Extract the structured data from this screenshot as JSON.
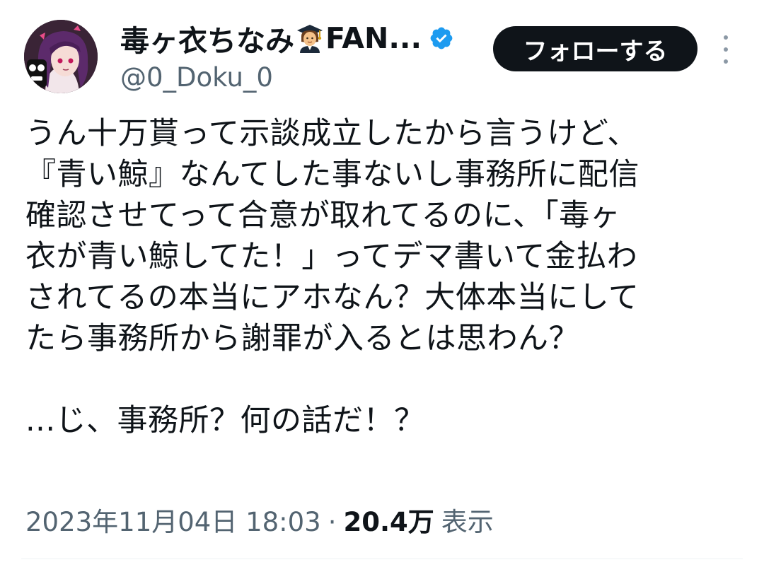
{
  "author": {
    "display_name": "毒ヶ衣ちなみ",
    "name_emoji": "graduate-emoji",
    "name_suffix": "FAN...",
    "handle": "@0_Doku_0",
    "verified": true,
    "verified_color": "#1d9bf0"
  },
  "actions": {
    "follow_label": "フォローする",
    "follow_bg": "#0f1419"
  },
  "tweet": {
    "lines": [
      "うん十万貰って示談成立したから言うけど、",
      "『青い鯨』なんてした事ないし事務所に配信",
      "確認させてって合意が取れてるのに、「毒ヶ",
      "衣が青い鯨してた！」ってデマ書いて金払わ",
      "されてるの本当にアホなん？大体本当にして",
      "たら事務所から謝罪が入るとは思わん？",
      "",
      "...じ、事務所？何の話だ！？"
    ]
  },
  "meta": {
    "timestamp": "2023年11月04日 18:03",
    "separator": "·",
    "views_count": "20.4万",
    "views_label": "表示"
  }
}
